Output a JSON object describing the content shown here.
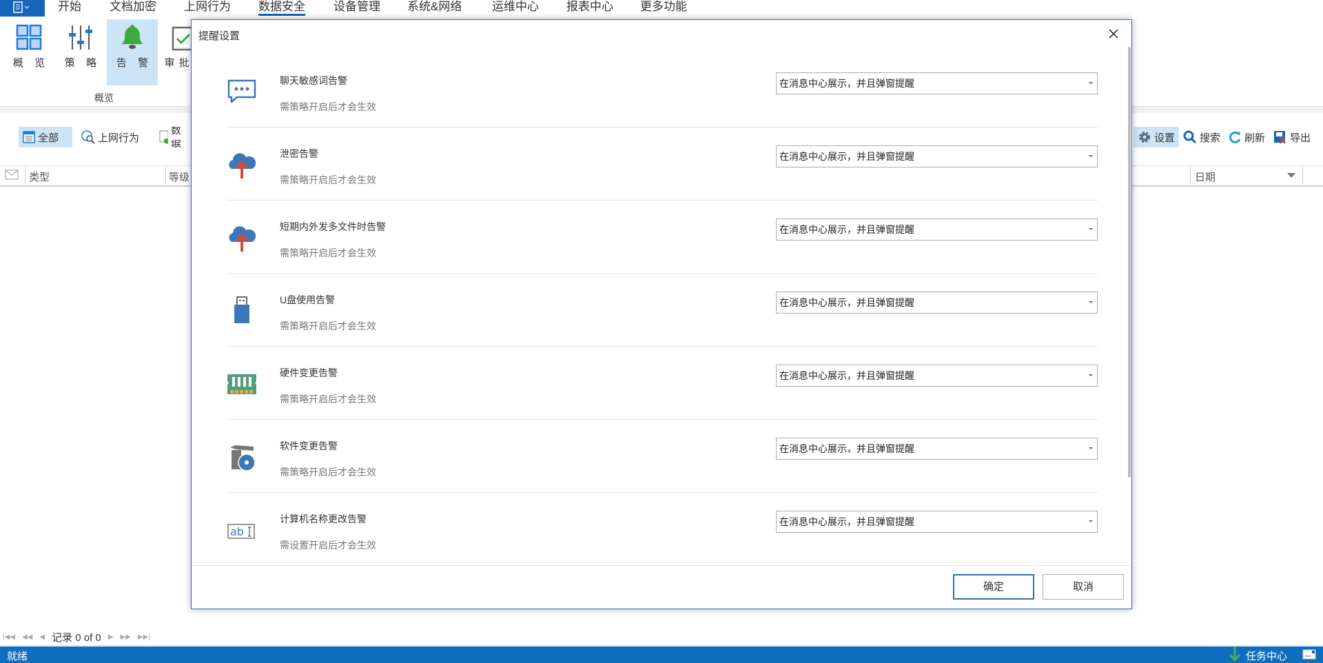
{
  "menu": {
    "items": [
      "开始",
      "文档加密",
      "上网行为",
      "数据安全",
      "设备管理",
      "系统&网络",
      "运维中心",
      "报表中心",
      "更多功能"
    ],
    "active": "数据安全"
  },
  "ribbon": {
    "buttons": [
      "概 览",
      "策 略",
      "告 警",
      "审批任"
    ],
    "group_label": "概览"
  },
  "filters": {
    "all": "全部",
    "web": "上网行为",
    "data": "数据"
  },
  "tools": {
    "settings": "设置",
    "search": "搜索",
    "refresh": "刷新",
    "export": "导出"
  },
  "table": {
    "columns": [
      "类型",
      "等级",
      "日期"
    ]
  },
  "pager": {
    "text": "记录 0 of 0"
  },
  "status": {
    "text": "就绪",
    "task_center": "任务中心"
  },
  "dialog": {
    "title": "提醒设置",
    "rows": [
      {
        "icon": "chat-bubble-icon",
        "title": "聊天敏感词告警",
        "sub": "需策略开启后才会生效",
        "value": "在消息中心展示，并且弹窗提醒"
      },
      {
        "icon": "cloud-upload-icon",
        "title": "泄密告警",
        "sub": "需策略开启后才会生效",
        "value": "在消息中心展示，并且弹窗提醒"
      },
      {
        "icon": "cloud-upload-icon",
        "title": "短期内外发多文件时告警",
        "sub": "需策略开启后才会生效",
        "value": "在消息中心展示，并且弹窗提醒"
      },
      {
        "icon": "usb-drive-icon",
        "title": "U盘使用告警",
        "sub": "需策略开启后才会生效",
        "value": "在消息中心展示，并且弹窗提醒"
      },
      {
        "icon": "memory-chip-icon",
        "title": "硬件变更告警",
        "sub": "需策略开启后才会生效",
        "value": "在消息中心展示，并且弹窗提醒"
      },
      {
        "icon": "software-box-icon",
        "title": "软件变更告警",
        "sub": "需策略开启后才会生效",
        "value": "在消息中心展示，并且弹窗提醒"
      },
      {
        "icon": "rename-text-icon",
        "title": "计算机名称更改告警",
        "sub": "需设置开启后才会生效",
        "value": "在消息中心展示，并且弹窗提醒"
      }
    ],
    "ok": "确定",
    "cancel": "取消"
  },
  "colors": {
    "accent": "#1565b8",
    "status_bar": "#0f6ebe",
    "highlight": "#cce4f7"
  }
}
